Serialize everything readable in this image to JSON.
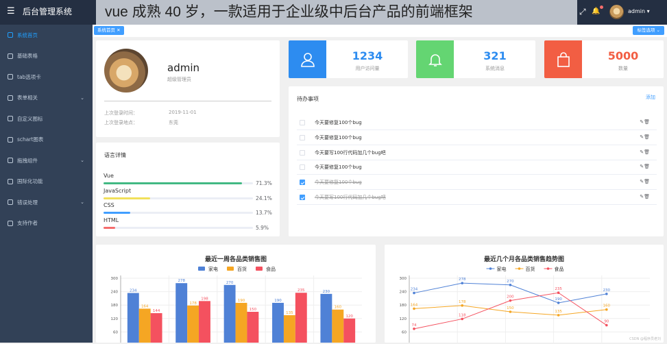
{
  "header": {
    "menu_icon": "☰",
    "title": "后台管理系统",
    "banner": "vue 成熟 40 岁，一款适用于企业级中后台产品的前端框架",
    "fullscreen_icon": "⤢",
    "bell_icon": "🔔",
    "username": "admin ▾"
  },
  "sidebar": {
    "items": [
      {
        "label": "系统首页",
        "icon": "home-icon"
      },
      {
        "label": "基础表格",
        "icon": "grid-icon"
      },
      {
        "label": "tab选项卡",
        "icon": "copy-icon"
      },
      {
        "label": "表单相关",
        "icon": "calendar-icon"
      },
      {
        "label": "自定义图标",
        "icon": "smile-icon"
      },
      {
        "label": "schart图表",
        "icon": "pie-icon"
      },
      {
        "label": "拖拽组件",
        "icon": "drag-icon"
      },
      {
        "label": "国际化功能",
        "icon": "globe-icon"
      },
      {
        "label": "错误处理",
        "icon": "warning-icon"
      },
      {
        "label": "支持作者",
        "icon": "donate-icon"
      }
    ]
  },
  "tags": {
    "active": "系统首页 ✕",
    "options": "标签选项 ⌄"
  },
  "user_card": {
    "name": "admin",
    "role": "超级管理员",
    "last_login_label": "上次登录时间：",
    "last_login": "2019-11-01",
    "last_place_label": "上次登录地点：",
    "last_place": "东莞"
  },
  "languages": {
    "title": "语言详情",
    "items": [
      {
        "name": "Vue",
        "pct": "71.3%",
        "value": 71.3,
        "color": "#42b983"
      },
      {
        "name": "JavaScript",
        "pct": "24.1%",
        "value": 24.1,
        "color": "#f1e05a"
      },
      {
        "name": "CSS",
        "pct": "13.7%",
        "value": 13.7,
        "color": "#409eff"
      },
      {
        "name": "HTML",
        "pct": "5.9%",
        "value": 5.9,
        "color": "#f56c6c"
      }
    ]
  },
  "stats": [
    {
      "num": "1234",
      "label": "用户访问量",
      "color": "#2d8cf0"
    },
    {
      "num": "321",
      "label": "系统消息",
      "color": "#64d572"
    },
    {
      "num": "5000",
      "label": "数量",
      "color": "#f25e43"
    }
  ],
  "todo": {
    "title": "待办事项",
    "add": "添加",
    "actions": "✎🗑",
    "items": [
      {
        "text": "今天要修复100个bug",
        "done": false
      },
      {
        "text": "今天要修复100个bug",
        "done": false
      },
      {
        "text": "今天要写100行代码加几个bug吧",
        "done": false
      },
      {
        "text": "今天要修复100个bug",
        "done": false
      },
      {
        "text": "今天要修复100个bug",
        "done": true
      },
      {
        "text": "今天要写100行代码加几个bug吧",
        "done": true
      }
    ]
  },
  "chart_data": [
    {
      "type": "bar",
      "title": "最近一周各品类销售图",
      "ylim": [
        0,
        300
      ],
      "categories": [
        "",
        "",
        "",
        "",
        ""
      ],
      "y_ticks": [
        60,
        120,
        180,
        240,
        300
      ],
      "series": [
        {
          "name": "家电",
          "color": "#4f81d6",
          "values": [
            234,
            278,
            270,
            190,
            230
          ]
        },
        {
          "name": "百货",
          "color": "#f5a623",
          "values": [
            164,
            178,
            190,
            135,
            160
          ]
        },
        {
          "name": "食品",
          "color": "#f4515f",
          "values": [
            144,
            198,
            150,
            235,
            120
          ]
        }
      ]
    },
    {
      "type": "line",
      "title": "最近几个月各品类销售趋势图",
      "ylim": [
        0,
        300
      ],
      "categories": [
        "",
        "",
        "",
        "",
        ""
      ],
      "y_ticks": [
        60,
        120,
        180,
        240,
        300
      ],
      "series": [
        {
          "name": "家电",
          "color": "#4f81d6",
          "values": [
            234,
            278,
            270,
            190,
            230
          ]
        },
        {
          "name": "百货",
          "color": "#f5a623",
          "values": [
            164,
            178,
            150,
            135,
            160
          ]
        },
        {
          "name": "食品",
          "color": "#f4515f",
          "values": [
            74,
            118,
            200,
            235,
            90
          ]
        }
      ]
    }
  ],
  "watermark": "CSDN @程序员老刘"
}
